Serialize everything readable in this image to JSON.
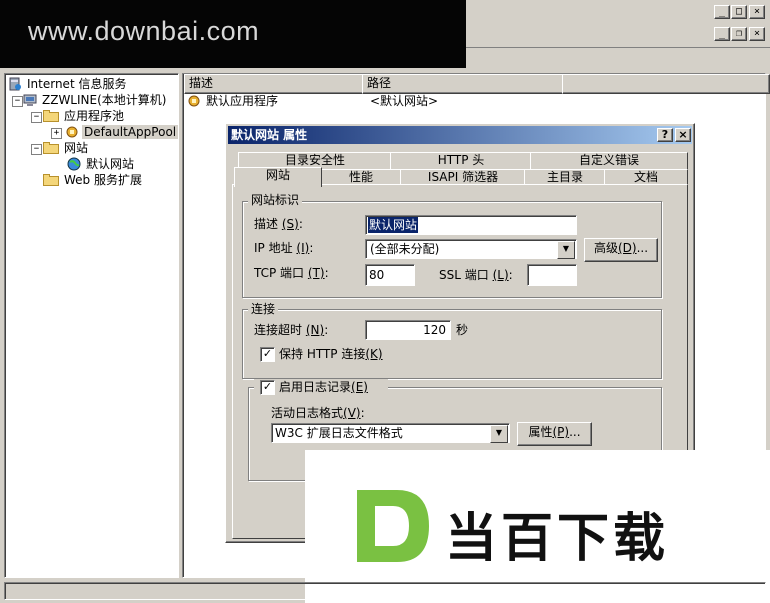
{
  "watermark": "www.downbai.com",
  "tree": {
    "items": [
      {
        "label": "Internet 信息服务"
      },
      {
        "label": "ZZWLINE(本地计算机)"
      },
      {
        "label": "应用程序池"
      },
      {
        "label": "DefaultAppPool"
      },
      {
        "label": "网站"
      },
      {
        "label": "默认网站"
      },
      {
        "label": "Web 服务扩展"
      }
    ]
  },
  "list": {
    "columns": [
      "描述",
      "路径"
    ],
    "rows": [
      {
        "desc": "默认应用程序",
        "path": "<默认网站>"
      }
    ]
  },
  "dialog": {
    "title": "默认网站 属性",
    "tabs_row1": [
      "目录安全性",
      "HTTP 头",
      "自定义错误"
    ],
    "tabs_row2": [
      "网站",
      "性能",
      "ISAPI 筛选器",
      "主目录",
      "文档"
    ],
    "site_id": {
      "group": "网站标识",
      "desc_label": "描述",
      "desc_key": "(S)",
      "desc_value": "默认网站",
      "ip_label": "IP 地址",
      "ip_key": "(I)",
      "ip_value": "(全部未分配)",
      "advanced_label": "高级",
      "advanced_key": "(D)",
      "tcp_label": "TCP 端口",
      "tcp_key": "(T)",
      "tcp_value": "80",
      "ssl_label": "SSL 端口",
      "ssl_key": "(L)",
      "ssl_value": ""
    },
    "connection": {
      "group": "连接",
      "timeout_label": "连接超时",
      "timeout_key": "(N)",
      "timeout_value": "120",
      "timeout_unit": "秒",
      "keepalive_label": "保持 HTTP 连接",
      "keepalive_key": "(K)",
      "keepalive_checked": true
    },
    "logging": {
      "enable_label": "启用日志记录",
      "enable_key": "(E)",
      "enabled": true,
      "format_label": "活动日志格式",
      "format_key": "(V)",
      "format_value": "W3C 扩展日志文件格式",
      "props_label": "属性",
      "props_key": "(P)"
    }
  },
  "logo": {
    "letter": "D",
    "text": "当百下载",
    "color": "#7ac142"
  }
}
